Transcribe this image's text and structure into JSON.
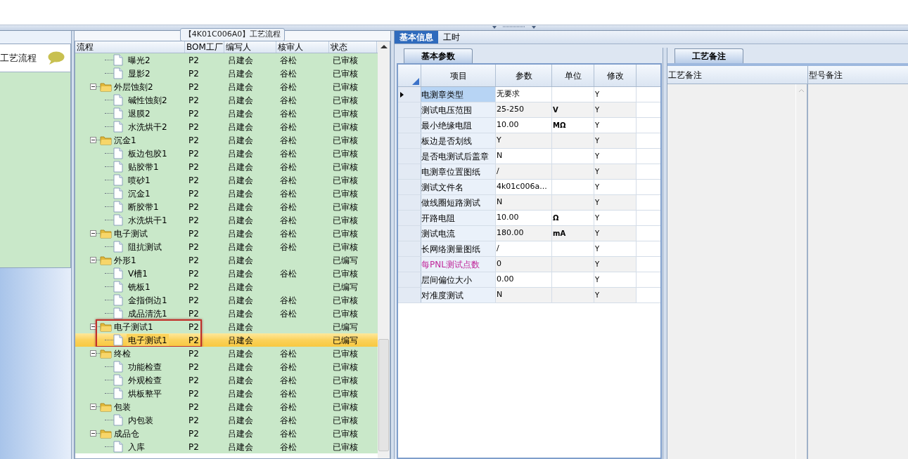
{
  "nav": {
    "title": "工艺流程"
  },
  "process": {
    "caption": "【4K01C006A0】工艺流程",
    "columns": [
      "流程",
      "BOM工厂",
      "编写人",
      "核审人",
      "状态"
    ],
    "rows": [
      {
        "kind": "file",
        "name": "曝光2",
        "plant": "P2",
        "writer": "吕建会",
        "reviewer": "谷松",
        "status": "已审核",
        "selected": false
      },
      {
        "kind": "file",
        "name": "显影2",
        "plant": "P2",
        "writer": "吕建会",
        "reviewer": "谷松",
        "status": "已审核",
        "selected": false
      },
      {
        "kind": "folder",
        "name": "外层蚀刻2",
        "plant": "P2",
        "writer": "吕建会",
        "reviewer": "谷松",
        "status": "已审核",
        "selected": false,
        "expanded": true,
        "outlined": false,
        "children": [
          {
            "kind": "file",
            "name": "碱性蚀刻2",
            "plant": "P2",
            "writer": "吕建会",
            "reviewer": "谷松",
            "status": "已审核",
            "selected": false
          },
          {
            "kind": "file",
            "name": "退膜2",
            "plant": "P2",
            "writer": "吕建会",
            "reviewer": "谷松",
            "status": "已审核",
            "selected": false
          },
          {
            "kind": "file",
            "name": "水洗烘干2",
            "plant": "P2",
            "writer": "吕建会",
            "reviewer": "谷松",
            "status": "已审核",
            "selected": false
          }
        ]
      },
      {
        "kind": "folder",
        "name": "沉金1",
        "plant": "P2",
        "writer": "吕建会",
        "reviewer": "谷松",
        "status": "已审核",
        "selected": false,
        "expanded": true,
        "outlined": false,
        "children": [
          {
            "kind": "file",
            "name": "板边包胶1",
            "plant": "P2",
            "writer": "吕建会",
            "reviewer": "谷松",
            "status": "已审核",
            "selected": false
          },
          {
            "kind": "file",
            "name": "贴胶带1",
            "plant": "P2",
            "writer": "吕建会",
            "reviewer": "谷松",
            "status": "已审核",
            "selected": false
          },
          {
            "kind": "file",
            "name": "喷砂1",
            "plant": "P2",
            "writer": "吕建会",
            "reviewer": "谷松",
            "status": "已审核",
            "selected": false
          },
          {
            "kind": "file",
            "name": "沉金1",
            "plant": "P2",
            "writer": "吕建会",
            "reviewer": "谷松",
            "status": "已审核",
            "selected": false
          },
          {
            "kind": "file",
            "name": "断胶带1",
            "plant": "P2",
            "writer": "吕建会",
            "reviewer": "谷松",
            "status": "已审核",
            "selected": false
          },
          {
            "kind": "file",
            "name": "水洗烘干1",
            "plant": "P2",
            "writer": "吕建会",
            "reviewer": "谷松",
            "status": "已审核",
            "selected": false
          }
        ]
      },
      {
        "kind": "folder",
        "name": "电子测试",
        "plant": "P2",
        "writer": "吕建会",
        "reviewer": "谷松",
        "status": "已审核",
        "selected": false,
        "expanded": true,
        "outlined": false,
        "children": [
          {
            "kind": "file",
            "name": "阻抗测试",
            "plant": "P2",
            "writer": "吕建会",
            "reviewer": "谷松",
            "status": "已审核",
            "selected": false
          }
        ]
      },
      {
        "kind": "folder",
        "name": "外形1",
        "plant": "P2",
        "writer": "吕建会",
        "status": "已编写",
        "selected": false,
        "expanded": true,
        "outlined": false,
        "children": [
          {
            "kind": "file",
            "name": "V槽1",
            "plant": "P2",
            "writer": "吕建会",
            "reviewer": "谷松",
            "status": "已审核",
            "selected": false
          },
          {
            "kind": "file",
            "name": "铣板1",
            "plant": "P2",
            "writer": "吕建会",
            "status": "已编写",
            "selected": false
          },
          {
            "kind": "file",
            "name": "金指倒边1",
            "plant": "P2",
            "writer": "吕建会",
            "reviewer": "谷松",
            "status": "已审核",
            "selected": false
          },
          {
            "kind": "file",
            "name": "成品清洗1",
            "plant": "P2",
            "writer": "吕建会",
            "reviewer": "谷松",
            "status": "已审核",
            "selected": false
          }
        ]
      },
      {
        "kind": "folder",
        "name": "电子测试1",
        "plant": "P2",
        "writer": "吕建会",
        "status": "已编写",
        "selected": false,
        "expanded": true,
        "outlined": true,
        "children": [
          {
            "kind": "file",
            "name": "电子测试1",
            "plant": "P2",
            "writer": "吕建会",
            "status": "已编写",
            "selected": true
          }
        ]
      },
      {
        "kind": "folder",
        "name": "终检",
        "plant": "P2",
        "writer": "吕建会",
        "reviewer": "谷松",
        "status": "已审核",
        "selected": false,
        "expanded": true,
        "outlined": false,
        "children": [
          {
            "kind": "file",
            "name": "功能检查",
            "plant": "P2",
            "writer": "吕建会",
            "reviewer": "谷松",
            "status": "已审核",
            "selected": false
          },
          {
            "kind": "file",
            "name": "外观检查",
            "plant": "P2",
            "writer": "吕建会",
            "reviewer": "谷松",
            "status": "已审核",
            "selected": false
          },
          {
            "kind": "file",
            "name": "烘板整平",
            "plant": "P2",
            "writer": "吕建会",
            "reviewer": "谷松",
            "status": "已审核",
            "selected": false
          }
        ]
      },
      {
        "kind": "folder",
        "name": "包装",
        "plant": "P2",
        "writer": "吕建会",
        "reviewer": "谷松",
        "status": "已审核",
        "selected": false,
        "expanded": true,
        "outlined": false,
        "children": [
          {
            "kind": "file",
            "name": "内包装",
            "plant": "P2",
            "writer": "吕建会",
            "reviewer": "谷松",
            "status": "已审核",
            "selected": false
          }
        ]
      },
      {
        "kind": "folder",
        "name": "成品仓",
        "plant": "P2",
        "writer": "吕建会",
        "reviewer": "谷松",
        "status": "已审核",
        "selected": false,
        "expanded": true,
        "outlined": false,
        "children": [
          {
            "kind": "file",
            "name": "入库",
            "plant": "P2",
            "writer": "吕建会",
            "reviewer": "谷松",
            "status": "已审核",
            "selected": false
          }
        ]
      }
    ]
  },
  "tabs": [
    {
      "label": "基本信息",
      "selected": true
    },
    {
      "label": "工时",
      "selected": false
    }
  ],
  "params": {
    "tab": "基本参数",
    "columns": [
      "项目",
      "参数",
      "单位",
      "修改"
    ],
    "rows": [
      {
        "item": "电测章类型",
        "value": "无要求",
        "modified": "Y",
        "selected": true
      },
      {
        "item": "测试电压范围",
        "value": "25-250",
        "unit": "V",
        "modified": "Y",
        "selected": false
      },
      {
        "item": "最小绝缘电阻",
        "value": "10.00",
        "unit": "MΩ",
        "modified": "Y",
        "selected": false
      },
      {
        "item": "板边是否划线",
        "value": "Y",
        "modified": "Y",
        "selected": false
      },
      {
        "item": "是否电测试后盖章",
        "value": "N",
        "modified": "Y",
        "selected": false
      },
      {
        "item": "电测章位置图纸",
        "value": "/",
        "modified": "Y",
        "selected": false
      },
      {
        "item": "测试文件名",
        "value": "4k01c006a...",
        "modified": "Y",
        "selected": false
      },
      {
        "item": "做线圈短路测试",
        "value": "N",
        "modified": "Y",
        "selected": false
      },
      {
        "item": "开路电阻",
        "value": "10.00",
        "unit": "Ω",
        "modified": "Y",
        "selected": false
      },
      {
        "item": "测试电流",
        "value": "180.00",
        "unit": "mA",
        "modified": "Y",
        "selected": false
      },
      {
        "item": "长网络测量图纸",
        "value": "/",
        "modified": "Y",
        "selected": false
      },
      {
        "item": "每PNL测试点数",
        "value": "0",
        "modified": "Y",
        "color": "#c0289a",
        "selected": false
      },
      {
        "item": "层间偏位大小",
        "value": "0.00",
        "modified": "Y",
        "selected": false
      },
      {
        "item": "对准度测试",
        "value": "N",
        "modified": "Y",
        "selected": false
      }
    ]
  },
  "notes": {
    "tab": "工艺备注",
    "columns": [
      "工艺备注",
      "型号备注"
    ]
  }
}
